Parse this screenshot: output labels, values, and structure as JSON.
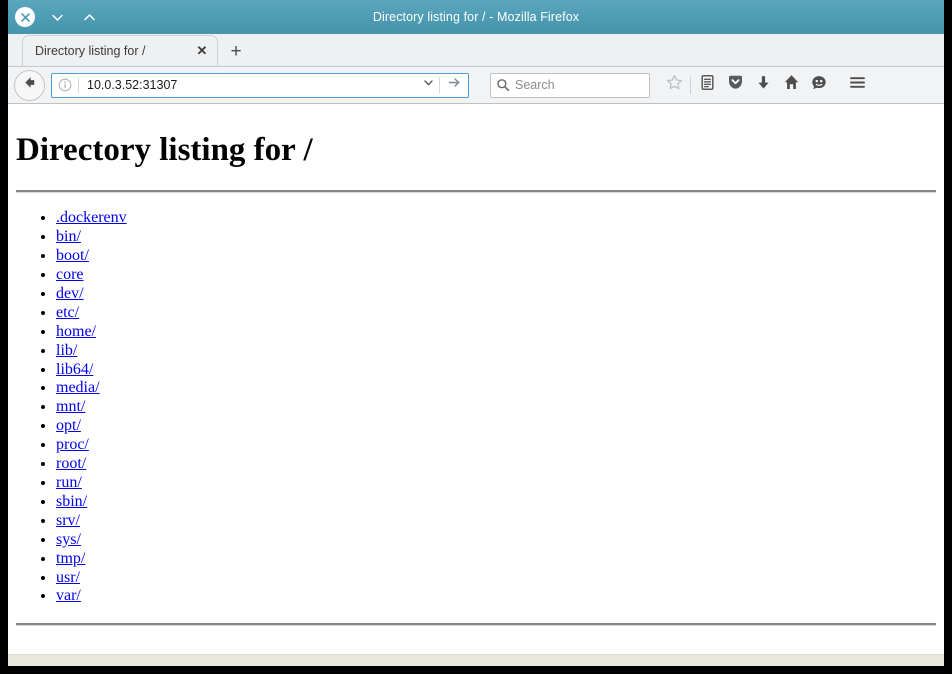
{
  "window": {
    "title": "Directory listing for / - Mozilla Firefox",
    "controls": {
      "close": "close-icon",
      "minimize": "chevron-down-icon",
      "maximize": "chevron-up-icon"
    },
    "titlebar_color": "#4e9cb4"
  },
  "tabs": {
    "items": [
      {
        "label": "Directory listing for /",
        "close_label": "✕"
      }
    ],
    "new_tab_label": "+"
  },
  "toolbar": {
    "back_label": "back-icon",
    "url": {
      "value": "10.0.3.52:31307",
      "placeholder": "Search or enter address",
      "identity_icon": "info-icon",
      "dropdown_icon": "chevron-down-icon",
      "go_icon": "arrow-right-icon"
    },
    "search": {
      "placeholder": "Search",
      "icon": "search-icon"
    },
    "icons": [
      {
        "name": "bookmark-star-icon"
      },
      {
        "name": "library-icon"
      },
      {
        "name": "pocket-icon"
      },
      {
        "name": "downloads-icon"
      },
      {
        "name": "home-icon"
      },
      {
        "name": "sync-account-icon"
      },
      {
        "name": "hamburger-menu-icon"
      }
    ]
  },
  "page": {
    "heading": "Directory listing for /",
    "link_color": "#0000ee",
    "entries": [
      ".dockerenv",
      "bin/",
      "boot/",
      "core",
      "dev/",
      "etc/",
      "home/",
      "lib/",
      "lib64/",
      "media/",
      "mnt/",
      "opt/",
      "proc/",
      "root/",
      "run/",
      "sbin/",
      "srv/",
      "sys/",
      "tmp/",
      "usr/",
      "var/"
    ]
  }
}
